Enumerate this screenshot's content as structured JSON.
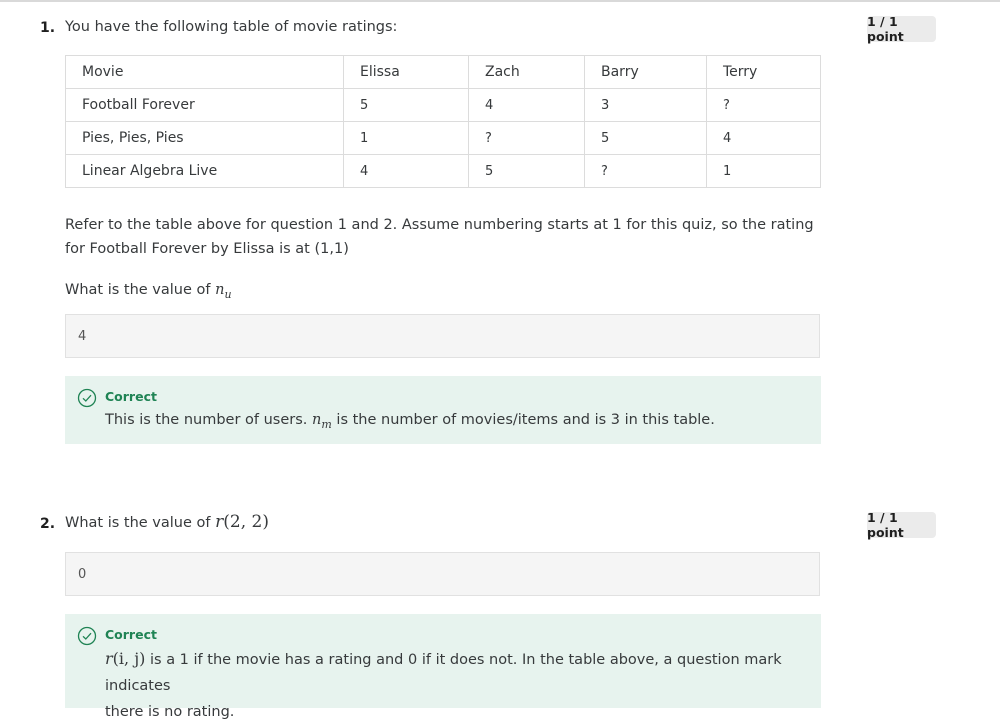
{
  "q1": {
    "number": "1.",
    "prompt": "You have the following table of movie ratings:",
    "points": "1 / 1 point",
    "table": {
      "headers": [
        "Movie",
        "Elissa",
        "Zach",
        "Barry",
        "Terry"
      ],
      "rows": [
        [
          "Football Forever",
          "5",
          "4",
          "3",
          "?"
        ],
        [
          "Pies, Pies, Pies",
          "1",
          "?",
          "5",
          "4"
        ],
        [
          "Linear Algebra Live",
          "4",
          "5",
          "?",
          "1"
        ]
      ]
    },
    "instruction": "Refer to the table above for question 1 and 2. Assume numbering starts at 1 for this quiz, so the rating for Football Forever by Elissa is at (1,1)",
    "question_prefix": "What is the value of ",
    "question_math": "n",
    "question_math_sub": "u",
    "answer": "4",
    "feedback": {
      "status": "Correct",
      "text_before": "This is the number of users. ",
      "math": "n",
      "math_sub": "m",
      "text_after": " is the number of movies/items and is 3 in this table."
    }
  },
  "q2": {
    "number": "2.",
    "question_prefix": "What is the value of ",
    "question_math_var": "r",
    "question_math_args": "(2, 2)",
    "points": "1 / 1 point",
    "answer": "0",
    "feedback": {
      "status": "Correct",
      "math_var": "r",
      "math_args": "(i, j)",
      "text_after_math": " is a 1 if the movie has a rating and 0 if it does not. In the table above, a question mark indicates",
      "text_line2": "there is no rating."
    }
  },
  "colors": {
    "correct_green": "#1f8354",
    "feedback_bg": "#e7f3ee",
    "badge_bg": "#ebebeb",
    "answer_bg": "#f5f5f5"
  },
  "icons": {
    "feedback": "check-circle-icon"
  }
}
